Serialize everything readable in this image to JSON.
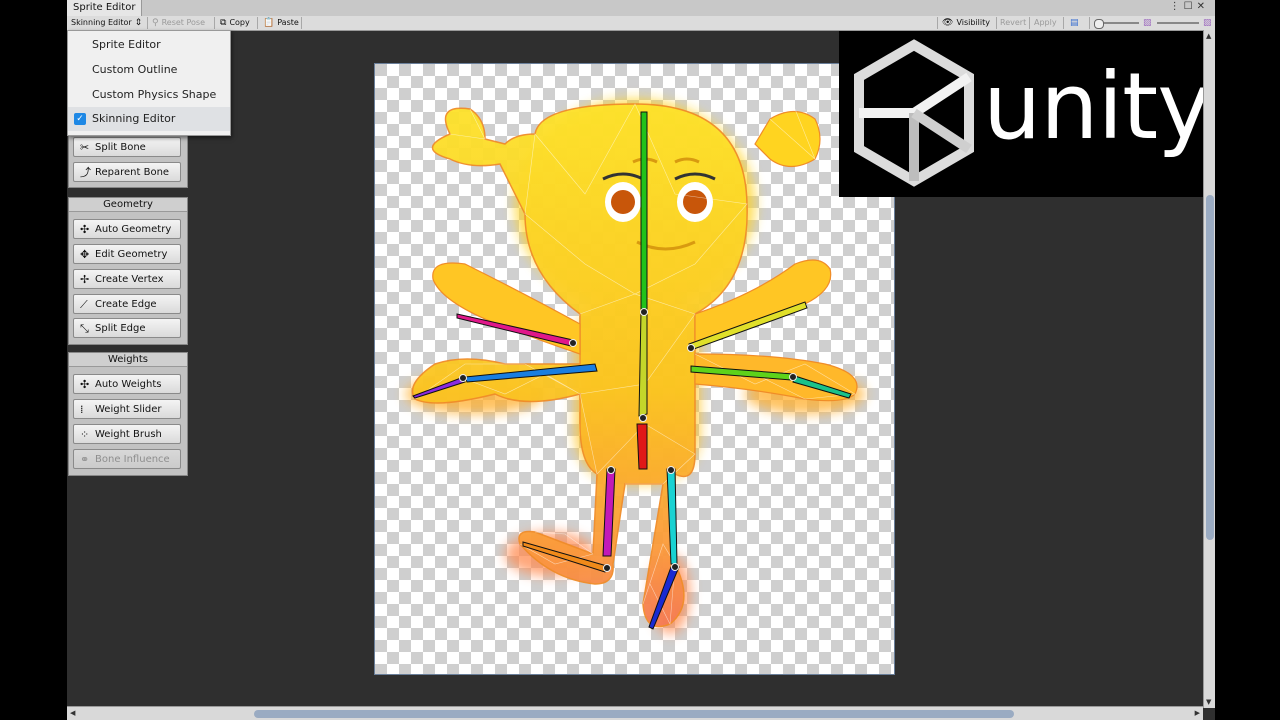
{
  "window": {
    "title": "Sprite Editor"
  },
  "toolbar": {
    "mode_select": "Skinning Editor",
    "reset_pose": "Reset Pose",
    "copy": "Copy",
    "paste": "Paste",
    "visibility": "Visibility",
    "revert": "Revert",
    "apply": "Apply"
  },
  "mode_dropdown": {
    "items": [
      {
        "label": "Sprite Editor",
        "checked": false
      },
      {
        "label": "Custom Outline",
        "checked": false
      },
      {
        "label": "Custom Physics Shape",
        "checked": false
      },
      {
        "label": "Skinning Editor",
        "checked": true
      }
    ]
  },
  "panels": {
    "bones": {
      "buttons": [
        "Split Bone",
        "Reparent Bone"
      ]
    },
    "geometry": {
      "header": "Geometry",
      "buttons": [
        "Auto Geometry",
        "Edit Geometry",
        "Create Vertex",
        "Create Edge",
        "Split Edge"
      ]
    },
    "weights": {
      "header": "Weights",
      "buttons": [
        "Auto Weights",
        "Weight Slider",
        "Weight Brush",
        "Bone Influence"
      ]
    }
  },
  "overlay": {
    "brand": "unity"
  },
  "colors": {
    "editor_bg": "#2f2f2f",
    "accent_check": "#1e88e5",
    "scroll_thumb": "#9aabc2"
  }
}
